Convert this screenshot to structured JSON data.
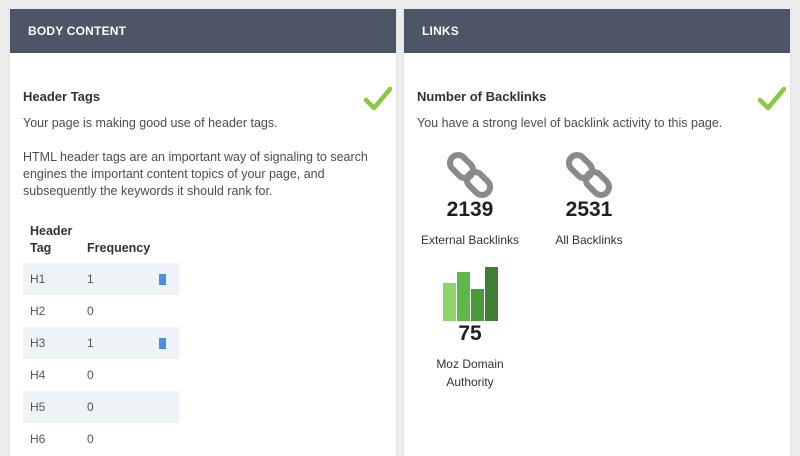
{
  "body_content": {
    "header": "BODY CONTENT",
    "section_title": "Header Tags",
    "summary": "Your page is making good use of header tags.",
    "description": "HTML header tags are an important way of signaling to search engines the important content topics of your page, and subsequently the keywords it should rank for.",
    "status_icon": "check-icon",
    "table": {
      "col_tag": "Header Tag",
      "col_freq": "Frequency",
      "rows": [
        {
          "tag": "H1",
          "freq": "1",
          "bar": true
        },
        {
          "tag": "H2",
          "freq": "0",
          "bar": false
        },
        {
          "tag": "H3",
          "freq": "1",
          "bar": true
        },
        {
          "tag": "H4",
          "freq": "0",
          "bar": false
        },
        {
          "tag": "H5",
          "freq": "0",
          "bar": false
        },
        {
          "tag": "H6",
          "freq": "0",
          "bar": false
        }
      ]
    }
  },
  "links": {
    "header": "LINKS",
    "section_title": "Number of Backlinks",
    "summary": "You have a strong level of backlink activity to this page.",
    "status_icon": "check-icon",
    "external": {
      "value": "2139",
      "label": "External Backlinks",
      "icon": "chain-link-icon"
    },
    "all": {
      "value": "2531",
      "label": "All Backlinks",
      "icon": "chain-link-icon"
    },
    "moz": {
      "value": "75",
      "label": "Moz Domain Authority",
      "icon": "bar-graph-icon"
    }
  },
  "colors": {
    "header_bg": "#4d5566",
    "check_green": "#8dc63f",
    "bar_blue": "#4a90e2",
    "row_alt": "#eef3f8",
    "moz_green": [
      "#8fd36d",
      "#5fb84a",
      "#4a9a3c",
      "#3f7f34"
    ]
  }
}
